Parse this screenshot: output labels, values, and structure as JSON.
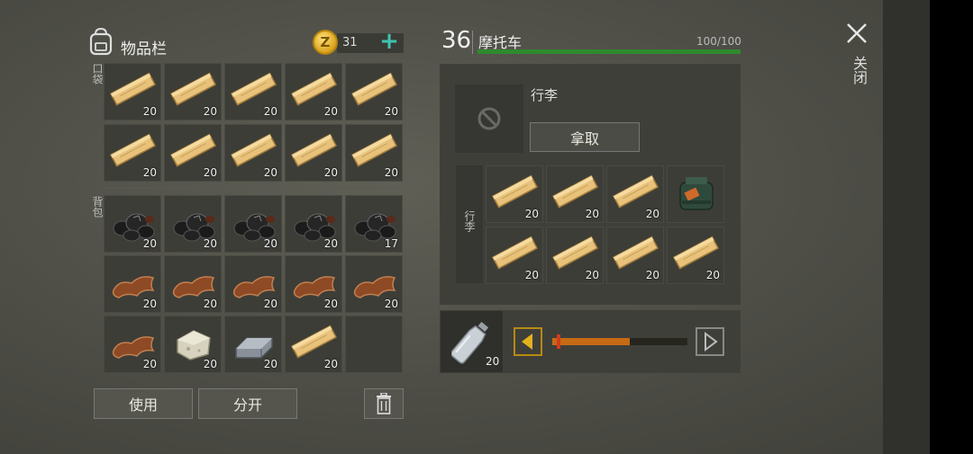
{
  "inventory": {
    "title": "物品栏",
    "coins": "31",
    "coin_symbol": "Z",
    "pocket_label": "口袋",
    "backpack_label": "背包",
    "pocket_items": [
      {
        "item": "plank",
        "count": "20"
      },
      {
        "item": "plank",
        "count": "20"
      },
      {
        "item": "plank",
        "count": "20"
      },
      {
        "item": "plank",
        "count": "20"
      },
      {
        "item": "plank",
        "count": "20"
      },
      {
        "item": "plank",
        "count": "20"
      },
      {
        "item": "plank",
        "count": "20"
      },
      {
        "item": "plank",
        "count": "20"
      },
      {
        "item": "plank",
        "count": "20"
      },
      {
        "item": "plank",
        "count": "20"
      }
    ],
    "backpack_items": [
      {
        "item": "coal",
        "count": "20"
      },
      {
        "item": "coal",
        "count": "20"
      },
      {
        "item": "coal",
        "count": "20"
      },
      {
        "item": "coal",
        "count": "20"
      },
      {
        "item": "coal",
        "count": "17"
      },
      {
        "item": "leather",
        "count": "20"
      },
      {
        "item": "leather",
        "count": "20"
      },
      {
        "item": "leather",
        "count": "20"
      },
      {
        "item": "leather",
        "count": "20"
      },
      {
        "item": "leather",
        "count": "20"
      },
      {
        "item": "leather",
        "count": "20"
      },
      {
        "item": "limestone",
        "count": "20"
      },
      {
        "item": "iron-ingot",
        "count": "20"
      },
      {
        "item": "plank",
        "count": "20"
      },
      {
        "item": "empty",
        "count": ""
      }
    ],
    "use_button": "使用",
    "split_button": "分开"
  },
  "vehicle": {
    "level": "36",
    "name": "摩托车",
    "hp": "100/100",
    "hp_fraction": 1.0,
    "bag_slot_label": "行李",
    "take_button": "拿取",
    "luggage_label": "行李",
    "luggage_items": [
      {
        "item": "plank",
        "count": "20"
      },
      {
        "item": "plank",
        "count": "20"
      },
      {
        "item": "plank",
        "count": "20"
      },
      {
        "item": "bag",
        "count": ""
      },
      {
        "item": "plank",
        "count": "20"
      },
      {
        "item": "plank",
        "count": "20"
      },
      {
        "item": "plank",
        "count": "20"
      },
      {
        "item": "plank",
        "count": "20"
      }
    ]
  },
  "quick": {
    "item": "water-bottle",
    "count": "20",
    "slider_fraction": 0.57
  },
  "close_label": "关闭",
  "colors": {
    "accent_teal": "#3fc4b0",
    "hp_green": "#2e8a2e",
    "slider_orange": "#c66a14",
    "coin_gold": "#d9a21c"
  }
}
